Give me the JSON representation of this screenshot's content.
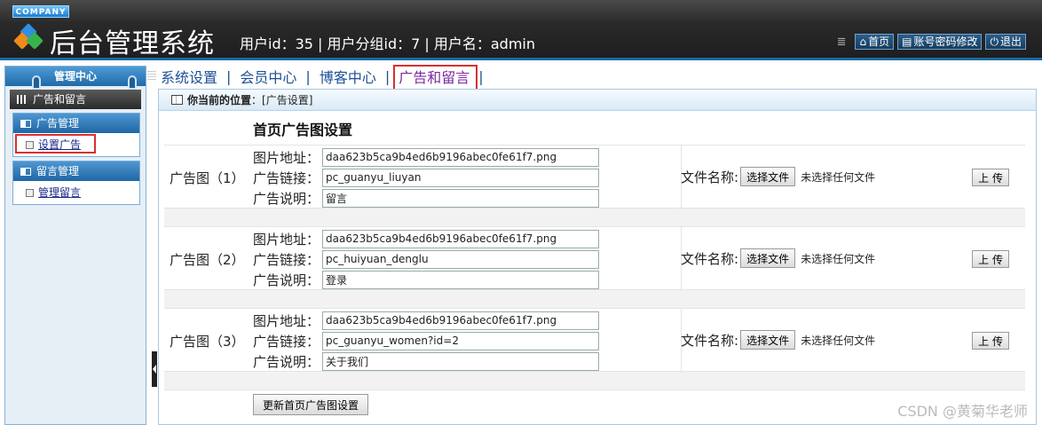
{
  "header": {
    "company_badge": "COMPANY",
    "app_title": "后台管理系统",
    "user_info": "用户id：35 | 用户分组id：7 | 用户名：admin",
    "links": [
      {
        "icon": "home-icon",
        "label": "首页"
      },
      {
        "icon": "account-icon",
        "label": "账号密码修改"
      },
      {
        "icon": "power-icon",
        "label": "退出"
      }
    ]
  },
  "sidebar": {
    "title": "管理中心",
    "section": "广告和留言",
    "groups": [
      {
        "title": "广告管理",
        "items": [
          {
            "label": "设置广告"
          }
        ]
      },
      {
        "title": "留言管理",
        "items": [
          {
            "label": "管理留言"
          }
        ]
      }
    ]
  },
  "nav": {
    "items": [
      {
        "label": "系统设置"
      },
      {
        "label": "会员中心"
      },
      {
        "label": "博客中心"
      },
      {
        "label": "广告和留言",
        "active": true
      }
    ],
    "separator": "|"
  },
  "breadcrumb": {
    "prefix": "你当前的位置",
    "value": "：[广告设置]"
  },
  "main": {
    "section_title": "首页广告图设置",
    "field_labels": {
      "image": "图片地址：",
      "link": "广告链接：",
      "desc": "广告说明："
    },
    "file_label": "文件名称:",
    "choose_file": "选择文件",
    "no_file": "未选择任何文件",
    "upload": "上 传",
    "ads": [
      {
        "label": "广告图（1）",
        "image": "daa623b5ca9b4ed6b9196abec0fe61f7.png",
        "link": "pc_guanyu_liuyan",
        "desc": "留言"
      },
      {
        "label": "广告图（2）",
        "image": "daa623b5ca9b4ed6b9196abec0fe61f7.png",
        "link": "pc_huiyuan_denglu",
        "desc": "登录"
      },
      {
        "label": "广告图（3）",
        "image": "daa623b5ca9b4ed6b9196abec0fe61f7.png",
        "link": "pc_guanyu_women?id=2",
        "desc": "关于我们"
      }
    ],
    "submit": "更新首页广告图设置"
  },
  "watermark": "CSDN @黄菊华老师",
  "colors": {
    "header_bg": "#2a2a2a",
    "accent_blue": "#1f6aa8",
    "highlight_red": "#d63030"
  }
}
